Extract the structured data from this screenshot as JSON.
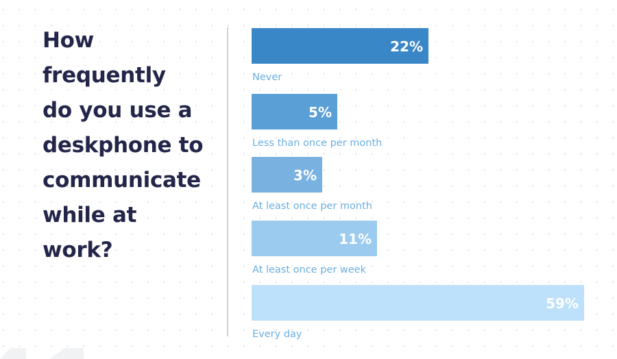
{
  "chart_data": {
    "type": "bar",
    "orientation": "horizontal",
    "title": "How frequently do you use a deskphone to communicate while at work?",
    "title_lines": [
      "How",
      "frequently",
      "do you use a",
      "deskphone to",
      "communicate",
      "while at",
      "work?"
    ],
    "categories": [
      "Never",
      "Less than once per month",
      "At least once per month",
      "At least once per week",
      "Every day"
    ],
    "values": [
      22,
      5,
      3,
      11,
      59
    ],
    "value_labels": [
      "22%",
      "5%",
      "3%",
      "11%",
      "59%"
    ],
    "unit": "%",
    "xlim": [
      0,
      59
    ],
    "xlabel": "",
    "ylabel": "",
    "grid": false,
    "legend": "none",
    "colors": [
      "#3a87c8",
      "#5a9fd6",
      "#79b1e1",
      "#9ccbf0",
      "#bde0fb"
    ],
    "label_color": "#6aaee0",
    "title_color": "#232649"
  }
}
